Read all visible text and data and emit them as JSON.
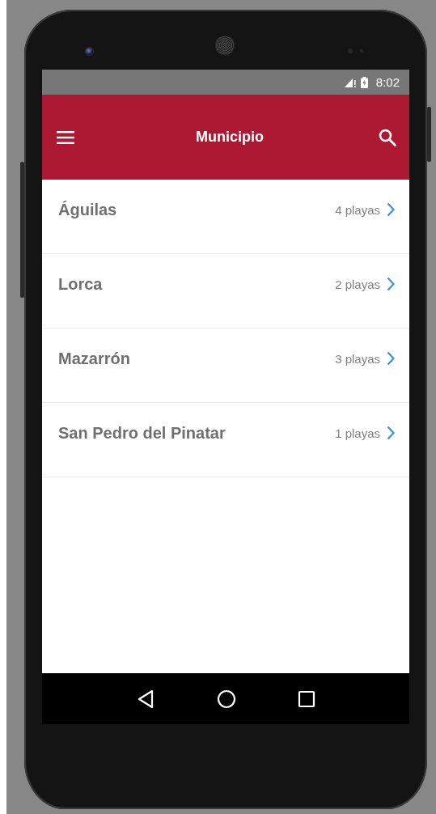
{
  "status_bar": {
    "time": "8:02"
  },
  "app_bar": {
    "title": "Municipio"
  },
  "municipalities": [
    {
      "name": "Águilas",
      "count": "4 playas"
    },
    {
      "name": "Lorca",
      "count": "2 playas"
    },
    {
      "name": "Mazarrón",
      "count": "3 playas"
    },
    {
      "name": "San Pedro del Pinatar",
      "count": "1 playas"
    }
  ]
}
